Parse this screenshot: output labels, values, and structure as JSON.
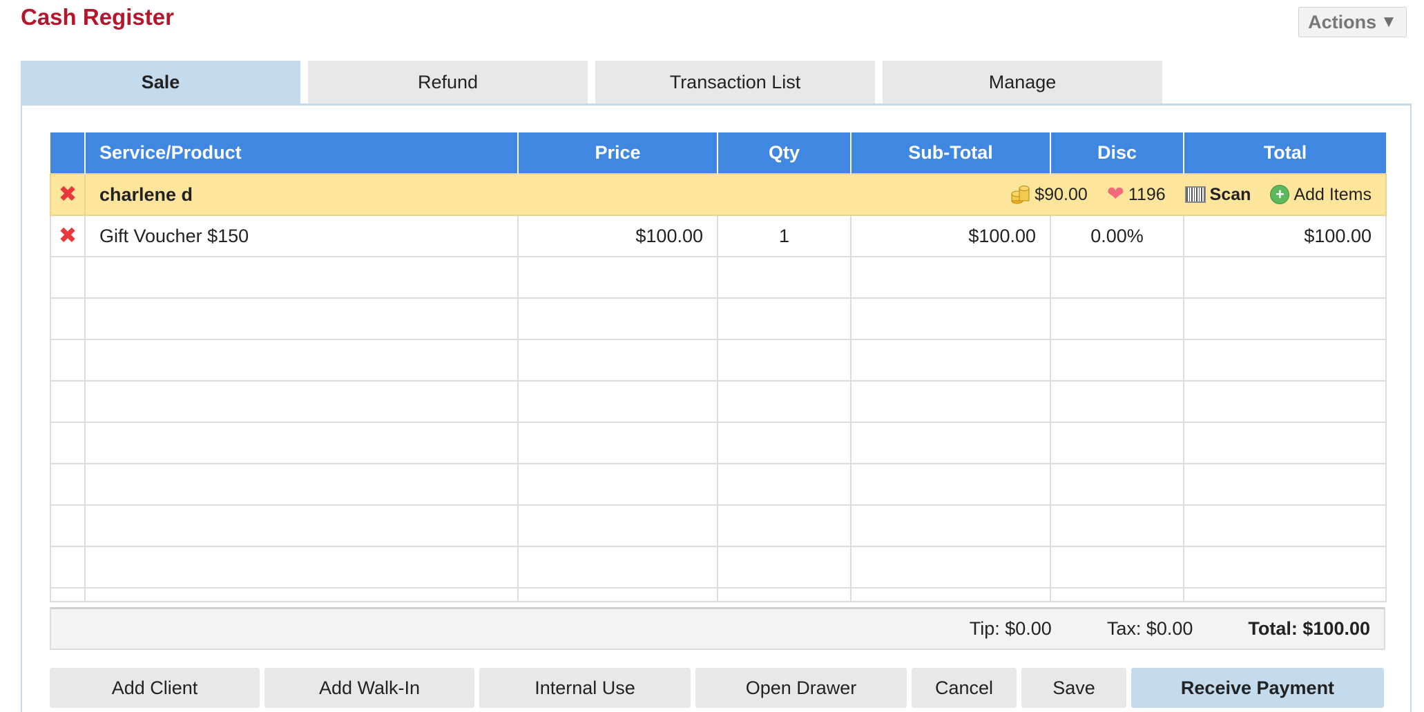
{
  "header": {
    "title": "Cash Register",
    "actions_label": "Actions"
  },
  "tabs": [
    {
      "label": "Sale",
      "active": true
    },
    {
      "label": "Refund",
      "active": false
    },
    {
      "label": "Transaction List",
      "active": false
    },
    {
      "label": "Manage",
      "active": false
    }
  ],
  "table": {
    "columns": [
      "Service/Product",
      "Price",
      "Qty",
      "Sub-Total",
      "Disc",
      "Total"
    ],
    "client": {
      "name": "charlene d",
      "balance": "$90.00",
      "points": "1196",
      "scan_label": "Scan",
      "add_items_label": "Add Items"
    },
    "items": [
      {
        "product": "Gift Voucher $150",
        "price": "$100.00",
        "qty": "1",
        "subtotal": "$100.00",
        "disc": "0.00%",
        "total": "$100.00"
      }
    ]
  },
  "summary": {
    "tip": "Tip: $0.00",
    "tax": "Tax: $0.00",
    "total": "Total: $100.00"
  },
  "buttons": {
    "add_client": "Add Client",
    "add_walkin": "Add Walk-In",
    "internal_use": "Internal Use",
    "open_drawer": "Open Drawer",
    "cancel": "Cancel",
    "save": "Save",
    "receive_payment": "Receive Payment"
  },
  "colors": {
    "title": "#b4172b",
    "header_blue": "#3f87e0",
    "active_tab": "#c3dbec",
    "client_row": "#fde59b",
    "remove_x": "#e8383b"
  }
}
